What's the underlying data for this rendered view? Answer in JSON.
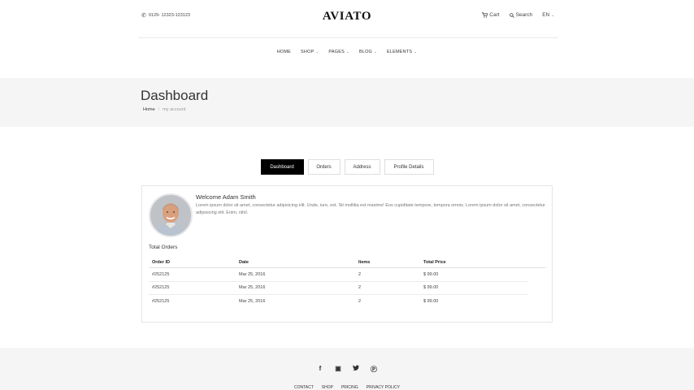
{
  "header": {
    "phone_icon": "phone-icon",
    "phone": "0129- 12323-123123",
    "logo": "AVIATO",
    "cart_label": "Cart",
    "search_label": "Search",
    "language": "EN"
  },
  "nav": {
    "items": [
      {
        "label": "HOME",
        "dropdown": false
      },
      {
        "label": "SHOP",
        "dropdown": true
      },
      {
        "label": "PAGES",
        "dropdown": true
      },
      {
        "label": "BLOG",
        "dropdown": true
      },
      {
        "label": "ELEMENTS",
        "dropdown": true
      }
    ]
  },
  "page": {
    "title": "Dashboard",
    "breadcrumb": [
      "Home",
      "my account"
    ]
  },
  "tabs": [
    {
      "label": "Dashboard",
      "active": true
    },
    {
      "label": "Orders",
      "active": false
    },
    {
      "label": "Address",
      "active": false
    },
    {
      "label": "Profile Details",
      "active": false
    }
  ],
  "dashboard": {
    "welcome": "Welcome Adam Smith",
    "body": "Lorem ipsum dolor sit amet, consectetur adipisicing elit. Unde, iure, est. Sit mollitia est maxime! Eos cupiditate tempore, tempora omnis. Lorem ipsum dolor sit amet, consectetur adipisicing elit. Enim, nihil.",
    "total_orders_label": "Total Orders",
    "table": {
      "headers": [
        "Order ID",
        "Date",
        "Items",
        "Total Price"
      ],
      "rows": [
        [
          "#252125",
          "Mar 25, 2016",
          "2",
          "$ 99.00"
        ],
        [
          "#252125",
          "Mar 25, 2016",
          "2",
          "$ 99.00"
        ],
        [
          "#252125",
          "Mar 25, 2016",
          "2",
          "$ 99.00"
        ]
      ]
    }
  },
  "footer": {
    "social_icons": [
      "facebook-icon",
      "instagram-icon",
      "twitter-icon",
      "pinterest-icon"
    ],
    "links": [
      "CONTACT",
      "SHOP",
      "PRICING",
      "PRIVACY POLICY"
    ]
  },
  "colors": {
    "accent": "#000000",
    "band_bg": "#f5f5f5",
    "border": "#e5e5e5"
  }
}
